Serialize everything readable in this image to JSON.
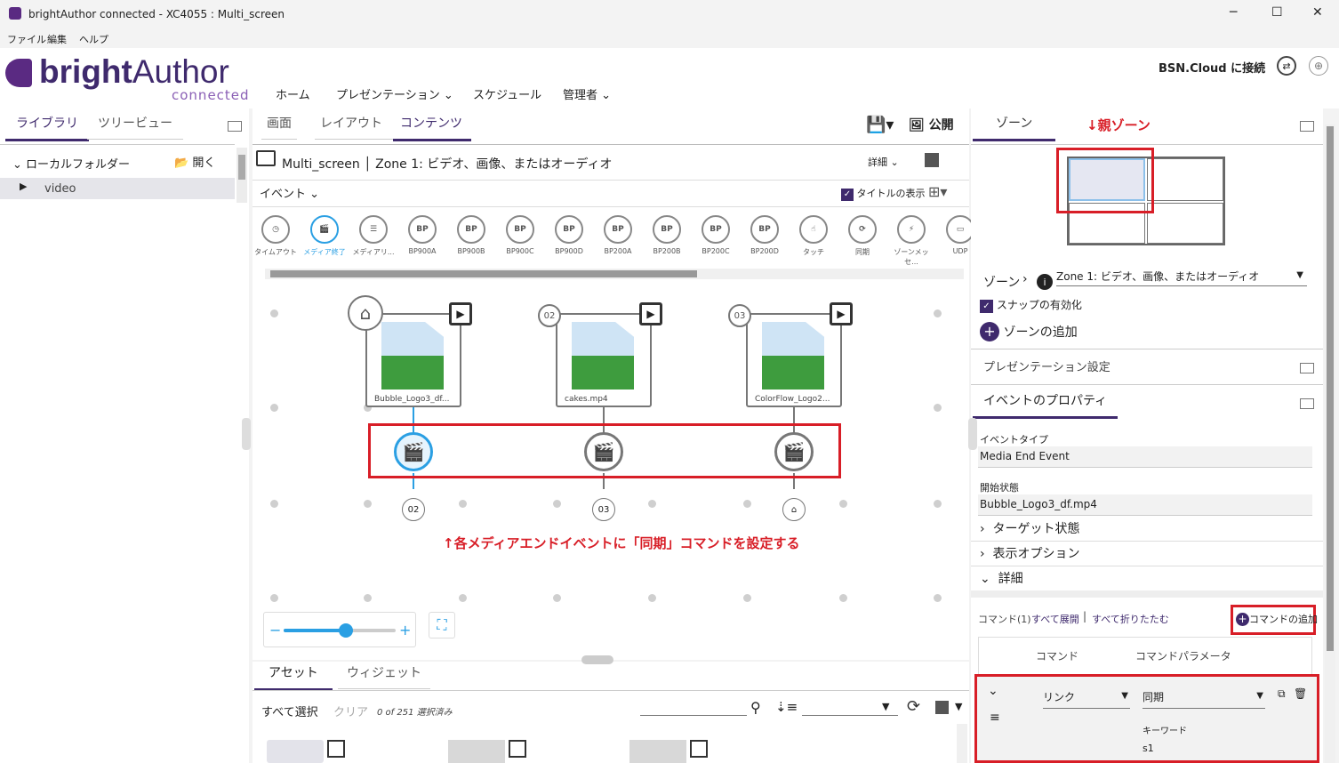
{
  "window": {
    "title": "brightAuthor connected - XC4055 : Multi_screen",
    "minimize": "─",
    "maximize": "☐",
    "close": "✕"
  },
  "menu": [
    "ファイル",
    "編集",
    "ヘルプ"
  ],
  "brand": {
    "logo_bold": "bright",
    "logo_light": "Author",
    "logo_sub": "connected",
    "accent": "#5a2a82"
  },
  "nav": {
    "home": "ホーム",
    "presentation": "プレゼンテーション",
    "schedule": "スケジュール",
    "admin": "管理者",
    "connect": "BSN.Cloud に接続"
  },
  "left": {
    "tabs": [
      "ライブラリ",
      "ツリービュー"
    ],
    "folder": "ローカルフォルダー",
    "open": "開く",
    "item": "video"
  },
  "center": {
    "tabs": [
      "画面",
      "レイアウト",
      "コンテンツ"
    ],
    "publish": "公開",
    "zone_title": "Multi_screen",
    "zone_sub": "Zone 1: ビデオ、画像、またはオーディオ",
    "detail": "詳細",
    "events_label": "イベント",
    "show_title": "タイトルの表示",
    "events": [
      "タイムアウト",
      "メディア終了",
      "メディアリ...",
      "BP900A",
      "BP900B",
      "BP900C",
      "BP900D",
      "BP200A",
      "BP200B",
      "BP200C",
      "BP200D",
      "タッチ",
      "同期",
      "ゾーンメッセ...",
      "UDP"
    ],
    "event_glyphs": [
      "◷",
      "🎬",
      "☰",
      "BP",
      "BP",
      "BP",
      "BP",
      "BP",
      "BP",
      "BP",
      "BP",
      "☝",
      "⟳",
      "⚡",
      "▭"
    ],
    "cards": [
      {
        "name": "Bubble_Logo3_df...",
        "badge": "⌂"
      },
      {
        "name": "cakes.mp4",
        "badge": "02"
      },
      {
        "name": "ColorFlow_Logo2...",
        "badge": "03"
      }
    ],
    "targets": [
      "02",
      "03",
      "⌂"
    ],
    "annotation": "↑各メディアエンドイベントに「同期」コマンドを設定する",
    "bottom_tabs": [
      "アセット",
      "ウィジェット"
    ],
    "select_all": "すべて選択",
    "clear": "クリア",
    "selected_count": "0 of 251 選択済み"
  },
  "right": {
    "tab_zone": "ゾーン",
    "annotation": "↓親ゾーン",
    "zone_label": "ゾーン",
    "zone_value": "Zone 1: ビデオ、画像、またはオーディオ",
    "snap": "スナップの有効化",
    "add_zone": "ゾーンの追加",
    "presentation_settings": "プレゼンテーション設定",
    "event_props": "イベントのプロパティ",
    "event_type_label": "イベントタイプ",
    "event_type_value": "Media End Event",
    "start_state_label": "開始状態",
    "start_state_value": "Bubble_Logo3_df.mp4",
    "target_state": "ターゲット状態",
    "display_options": "表示オプション",
    "details": "詳細",
    "commands_label": "コマンド(1)",
    "expand_all": "すべて展開",
    "collapse_all": "すべて折りたたむ",
    "add_command": "コマンドの追加",
    "col_command": "コマンド",
    "col_params": "コマンドパラメータ",
    "cmd_value": "リンク",
    "param_value": "同期",
    "keyword_label": "キーワード",
    "keyword_value": "s1"
  }
}
